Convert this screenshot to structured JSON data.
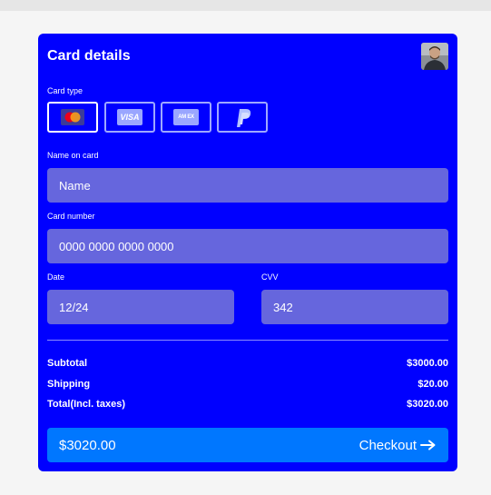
{
  "card": {
    "title": "Card details",
    "card_type_label": "Card type",
    "card_types": [
      {
        "name": "mastercard",
        "selected": true
      },
      {
        "name": "visa",
        "label": "VISA",
        "selected": false
      },
      {
        "name": "amex",
        "label": "AM EX",
        "selected": false
      },
      {
        "name": "paypal",
        "selected": false
      }
    ],
    "name_label": "Name on card",
    "name_placeholder": "Name",
    "number_label": "Card number",
    "number_placeholder": "0000 0000 0000 0000",
    "date_label": "Date",
    "date_value": "12/24",
    "cvv_label": "CVV",
    "cvv_value": "342"
  },
  "summary": {
    "subtotal_label": "Subtotal",
    "subtotal_value": "$3000.00",
    "shipping_label": "Shipping",
    "shipping_value": "$20.00",
    "total_label": "Total(Incl. taxes)",
    "total_value": "$3020.00"
  },
  "checkout": {
    "amount": "$3020.00",
    "label": "Checkout",
    "icon": "arrow-right-icon"
  },
  "colors": {
    "card_bg": "#0000ff",
    "field_bg": "#6666dd",
    "button_bg": "#0077ff"
  }
}
